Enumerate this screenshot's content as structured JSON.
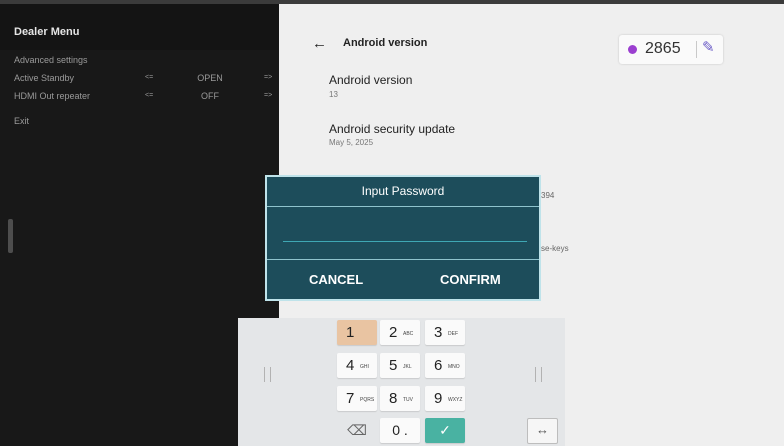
{
  "dealer_menu": {
    "title": "Dealer Menu",
    "section": "Advanced settings",
    "rows": [
      {
        "label": "Active Standby",
        "left": "<=",
        "value": "OPEN",
        "right": "=>"
      },
      {
        "label": "HDMI Out repeater",
        "left": "<=",
        "value": "OFF",
        "right": "=>"
      }
    ],
    "exit": "Exit"
  },
  "settings": {
    "back_icon": "←",
    "title": "Android version",
    "badge": {
      "number": "2865",
      "dot_color": "#9b3fd0",
      "icon": "✎"
    },
    "items": [
      {
        "title": "Android version",
        "subtitle": "13"
      },
      {
        "title": "Android security update",
        "subtitle": "May 5, 2025"
      }
    ],
    "peek_text_1": "394",
    "peek_text_2": "se-keys"
  },
  "dialog": {
    "title": "Input Password",
    "password_value": "",
    "cancel": "CANCEL",
    "confirm": "CONFIRM"
  },
  "keyboard": {
    "keys": [
      {
        "digit": "1",
        "sub": ""
      },
      {
        "digit": "2",
        "sub": "ABC"
      },
      {
        "digit": "3",
        "sub": "DEF"
      },
      {
        "digit": "4",
        "sub": "GHI"
      },
      {
        "digit": "5",
        "sub": "JKL"
      },
      {
        "digit": "6",
        "sub": "MNO"
      },
      {
        "digit": "7",
        "sub": "PQRS"
      },
      {
        "digit": "8",
        "sub": "TUV"
      },
      {
        "digit": "9",
        "sub": "WXYZ"
      }
    ],
    "backspace": "⌫",
    "zero": "0 .",
    "done": "✓",
    "swap": "↔",
    "accent_color": "#49b2a2",
    "highlight_color": "#e9c4a2"
  }
}
